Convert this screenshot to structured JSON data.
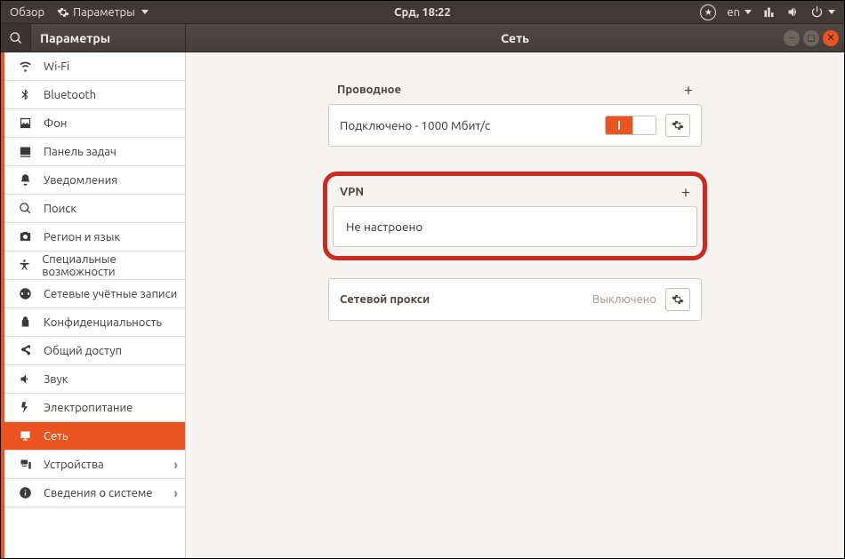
{
  "topbar": {
    "overview": "Обзор",
    "parameters": "Параметры",
    "clock": "Срд, 18:22",
    "lang": "en"
  },
  "window": {
    "search_aria": "Поиск",
    "sidebar_title": "Параметры",
    "main_title": "Сеть"
  },
  "sidebar": {
    "items": [
      {
        "id": "wifi",
        "label": "Wi-Fi",
        "icon": "wifi"
      },
      {
        "id": "bluetooth",
        "label": "Bluetooth",
        "icon": "bluetooth"
      },
      {
        "id": "background",
        "label": "Фон",
        "icon": "background"
      },
      {
        "id": "dock",
        "label": "Панель задач",
        "icon": "dock"
      },
      {
        "id": "notifications",
        "label": "Уведомления",
        "icon": "bell"
      },
      {
        "id": "search",
        "label": "Поиск",
        "icon": "search"
      },
      {
        "id": "region",
        "label": "Регион и язык",
        "icon": "region"
      },
      {
        "id": "accessibility",
        "label": "Специальные возможности",
        "icon": "accessibility"
      },
      {
        "id": "online",
        "label": "Сетевые учётные записи",
        "icon": "online"
      },
      {
        "id": "privacy",
        "label": "Конфиденциальность",
        "icon": "privacy"
      },
      {
        "id": "sharing",
        "label": "Общий доступ",
        "icon": "share"
      },
      {
        "id": "sound",
        "label": "Звук",
        "icon": "sound"
      },
      {
        "id": "power",
        "label": "Электропитание",
        "icon": "power"
      },
      {
        "id": "network",
        "label": "Сеть",
        "icon": "network",
        "active": true
      },
      {
        "id": "devices",
        "label": "Устройства",
        "icon": "devices",
        "chevron": true
      },
      {
        "id": "about",
        "label": "Сведения о системе",
        "icon": "about",
        "chevron": true
      }
    ]
  },
  "network": {
    "wired": {
      "title": "Проводное",
      "status": "Подключено - 1000 Мбит/с"
    },
    "vpn": {
      "title": "VPN",
      "status": "Не настроено"
    },
    "proxy": {
      "title": "Сетевой прокси",
      "state": "Выключено"
    }
  }
}
